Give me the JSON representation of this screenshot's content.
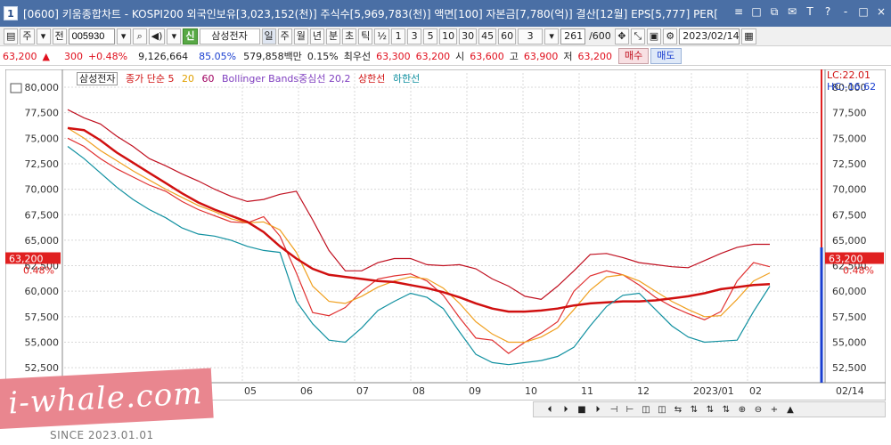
{
  "window": {
    "num": "1",
    "title": "[0600] 키움종합차트 - KOSPI200 외국인보유[3,023,152(천)] 주식수[5,969,783(천)] 액면[100] 자본금[7,780(억)] 결산[12월] EPS[5,777] PER[",
    "icons": [
      "≡",
      "□",
      "⧉",
      "✉",
      "T",
      "?",
      "-",
      "□",
      "×"
    ]
  },
  "toolbar": {
    "period_label": "주",
    "prev_label": "전",
    "code": "005930",
    "credit_label": "신",
    "stock_name": "삼성전자",
    "tabs": [
      "일",
      "주",
      "월",
      "년",
      "분",
      "초",
      "틱"
    ],
    "fraction_label": "½",
    "numbers": [
      "1",
      "3",
      "5",
      "10",
      "30",
      "45",
      "60"
    ],
    "count_value": "3",
    "range_current": "261",
    "range_total": "/600",
    "date": "2023/02/14"
  },
  "pricebar": {
    "price": "63,200",
    "change": "300",
    "change_pct": "+0.48%",
    "volume": "9,126,664",
    "volume_ratio": "85.05%",
    "trade_value": "579,858백만",
    "turnover": "0.15%",
    "pref_label": "최우선",
    "pref_ask": "63,300",
    "pref_bid": "63,200",
    "open_label": "시",
    "open": "63,600",
    "high_label": "고",
    "high": "63,900",
    "low_label": "저",
    "low": "63,200",
    "buy_label": "매수",
    "sell_label": "매도"
  },
  "chart_data": {
    "type": "line",
    "title": "",
    "legend": [
      "삼성전자",
      "종가 단순 5",
      "20",
      "60",
      "Bollinger Bands중심선 20,2",
      "상한선",
      "하한선"
    ],
    "legend_colors": [
      "#222222",
      "#d01010",
      "#e0a000",
      "#a00060",
      "#8040c0",
      "#d01010",
      "#1090a0"
    ],
    "x_tick_labels": [
      "05",
      "06",
      "07",
      "08",
      "09",
      "10",
      "11",
      "12",
      "2023/01",
      "02",
      "02/14"
    ],
    "y_ticks": [
      52500,
      55000,
      57500,
      60000,
      62500,
      65000,
      67500,
      70000,
      72500,
      75000,
      77500,
      80000
    ],
    "y_tick_labels": [
      "52,500",
      "55,000",
      "57,500",
      "60,000",
      "62,500",
      "65,000",
      "67,500",
      "70,000",
      "72,500",
      "75,000",
      "77,500",
      "80,000"
    ],
    "ylim": [
      51200,
      81400
    ],
    "current_price": 63200,
    "current_price_label": "63,200",
    "current_change_label": "0.48%",
    "lc_label": "LC:22.01",
    "hc_label": "HC:-16.62",
    "series": [
      {
        "name": "종가 단순 5",
        "color": "#e03030",
        "values": [
          75000,
          74200,
          73000,
          72000,
          71200,
          70400,
          69800,
          68800,
          68000,
          67400,
          66800,
          66700,
          67300,
          65400,
          61800,
          57900,
          57600,
          58400,
          60000,
          61200,
          61500,
          61700,
          61000,
          59600,
          57400,
          55400,
          55200,
          53900,
          55000,
          55900,
          57000,
          60000,
          61500,
          62000,
          61600,
          60600,
          59400,
          58500,
          57800,
          57200,
          58000,
          61000,
          62800,
          62400
        ]
      },
      {
        "name": "20",
        "color": "#f0a020",
        "values": [
          76000,
          75000,
          73800,
          72800,
          71800,
          70900,
          70000,
          69200,
          68400,
          67800,
          67100,
          66700,
          66800,
          66000,
          63800,
          60500,
          59000,
          58800,
          59500,
          60400,
          61000,
          61400,
          61200,
          60300,
          58800,
          57000,
          55800,
          55000,
          55000,
          55500,
          56400,
          58200,
          60100,
          61400,
          61600,
          61000,
          60000,
          59000,
          58200,
          57500,
          57600,
          59200,
          61000,
          61800
        ]
      },
      {
        "name": "Bollinger Bands중심선 20,2",
        "color": "#d01010",
        "values": [
          76000,
          75800,
          74800,
          73600,
          72600,
          71600,
          70600,
          69600,
          68700,
          68000,
          67400,
          66800,
          65800,
          64400,
          63200,
          62200,
          61600,
          61400,
          61200,
          61000,
          60900,
          60600,
          60300,
          59900,
          59400,
          58800,
          58300,
          58000,
          58000,
          58100,
          58300,
          58600,
          58800,
          58900,
          59000,
          59000,
          59100,
          59300,
          59500,
          59800,
          60200,
          60400,
          60600,
          60700
        ]
      },
      {
        "name": "상한선",
        "color": "#c01020",
        "values": [
          77800,
          77000,
          76400,
          75200,
          74200,
          73000,
          72300,
          71500,
          70800,
          70000,
          69300,
          68800,
          69000,
          69500,
          69800,
          67000,
          64000,
          62000,
          62000,
          62800,
          63200,
          63200,
          62600,
          62500,
          62600,
          62200,
          61200,
          60500,
          59500,
          59200,
          60500,
          62000,
          63600,
          63700,
          63300,
          62800,
          62600,
          62400,
          62300,
          63000,
          63700,
          64300,
          64600,
          64600
        ]
      },
      {
        "name": "하한선",
        "color": "#1090a0",
        "values": [
          74200,
          73000,
          71600,
          70200,
          69000,
          68000,
          67200,
          66200,
          65600,
          65400,
          65000,
          64400,
          64000,
          63800,
          59000,
          56800,
          55200,
          55000,
          56400,
          58100,
          59000,
          59800,
          59400,
          58300,
          56000,
          53800,
          53000,
          52800,
          53000,
          53200,
          53600,
          54500,
          56600,
          58500,
          59600,
          59800,
          58200,
          56600,
          55500,
          55000,
          55100,
          55200,
          58000,
          60500
        ]
      }
    ],
    "grid": true,
    "legend_position": "top-left"
  },
  "scrollbar": {
    "icons": [
      "⏴",
      "⏵",
      "■",
      "⏵",
      "⊣",
      "⊢",
      "◫",
      "◫",
      "⇆",
      "⇅",
      "⇅",
      "⇅",
      "⊕",
      "⊖",
      "+",
      "▲"
    ]
  },
  "watermark": {
    "text": "i-whale.com",
    "since": "SINCE 2023.01.01"
  }
}
